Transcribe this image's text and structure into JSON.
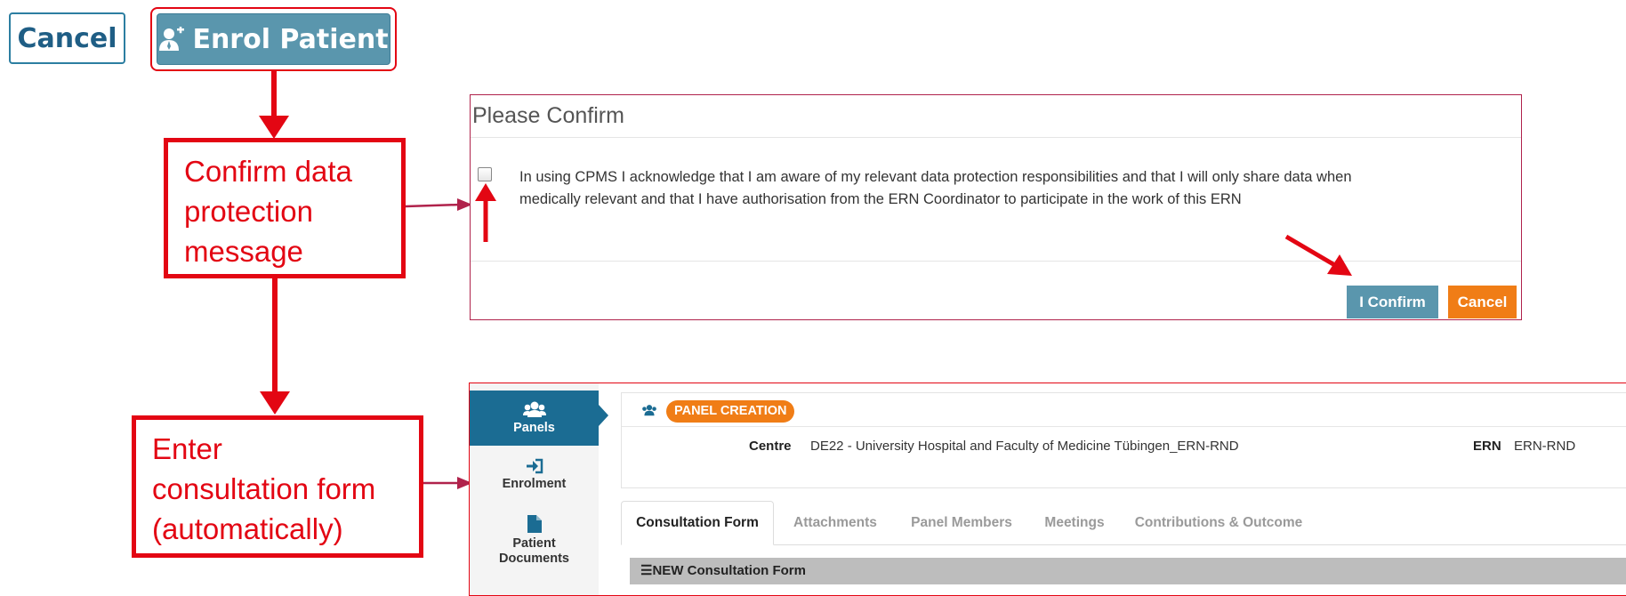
{
  "top_buttons": {
    "cancel_label": "Cancel",
    "enrol_label": "Enrol Patient",
    "enrol_icon": "user-plus-icon"
  },
  "annotations": {
    "confirm": "Confirm data\nprotection\nmessage",
    "enter": "Enter\nconsultation form\n(automatically)"
  },
  "dialog": {
    "title": "Please Confirm",
    "message": "In using CPMS I acknowledge that I am aware of my relevant data protection responsibilities and that I will only share data when medically relevant and that I have authorisation from the ERN Coordinator to participate in the work of this ERN",
    "confirm_label": "I Confirm",
    "cancel_label": "Cancel"
  },
  "app": {
    "sidebar": [
      {
        "label": "Panels",
        "icon": "users-icon",
        "active": true
      },
      {
        "label": "Enrolment",
        "icon": "sign-in-icon",
        "active": false
      },
      {
        "label": "Patient Documents",
        "icon": "file-icon",
        "active": false
      }
    ],
    "badge": "PANEL CREATION",
    "centre_label": "Centre",
    "centre_value": "DE22 - University Hospital and Faculty of Medicine Tübingen_ERN-RND",
    "ern_label": "ERN",
    "ern_value": "ERN-RND",
    "tabs": [
      "Consultation Form",
      "Attachments",
      "Panel Members",
      "Meetings",
      "Contributions & Outcome"
    ],
    "form_title": "NEW Consultation Form"
  },
  "colors": {
    "annotation_red": "#e30613",
    "primary_teal": "#5a96ad",
    "sidebar_active": "#1b6c93",
    "orange": "#f07d16"
  }
}
